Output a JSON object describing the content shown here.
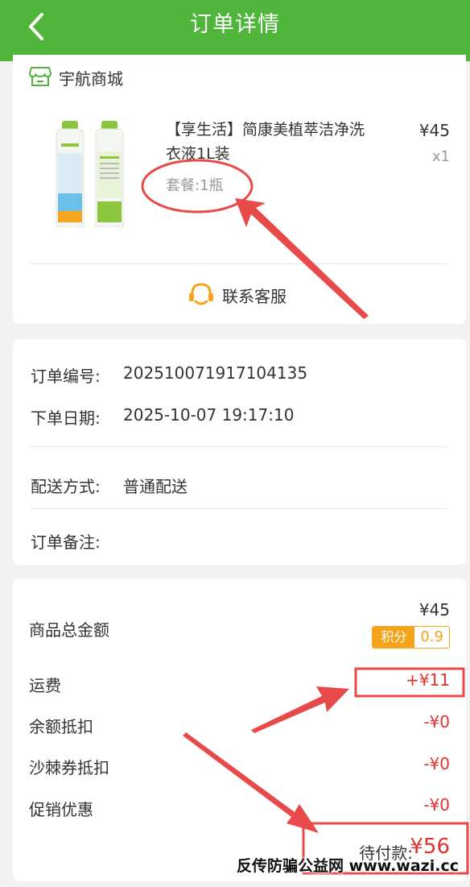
{
  "header": {
    "title": "订单详情",
    "back_icon": "chevron-left-icon",
    "color": "#4fb53b"
  },
  "store": {
    "name": "宇航商城",
    "icon": "store-icon"
  },
  "product": {
    "title": "【享生活】简康美植萃洁净洗衣液1L装",
    "spec": "套餐:1瓶",
    "price": "¥45",
    "quantity": "x1"
  },
  "service": {
    "label": "联系客服",
    "icon": "headset-icon"
  },
  "order_info": {
    "number_label": "订单编号:",
    "number_value": "20251007191710413​5",
    "date_label": "下单日期:",
    "date_value": "2025-10-07 19:17:10",
    "delivery_label": "配送方式:",
    "delivery_value": "普通配送",
    "note_label": "订单备注:"
  },
  "summary": {
    "goods_total_label": "商品总金额",
    "goods_total_value": "¥45",
    "points_label": "积分",
    "points_value": "0.9",
    "shipping_label": "运费",
    "shipping_value": "+¥11",
    "balance_label": "余额抵扣",
    "balance_value": "-¥0",
    "voucher_label": "沙棘券抵扣",
    "voucher_value": "-¥0",
    "promo_label": "促销优惠",
    "promo_value": "-¥0",
    "pending_label": "待付款:",
    "pending_value": "¥56"
  },
  "watermark": "反传防骗公益网 www.wazi.cc",
  "colors": {
    "price_red": "#e0332c",
    "points_orange": "#f5a31a",
    "annotation_red": "#e84a4a"
  }
}
